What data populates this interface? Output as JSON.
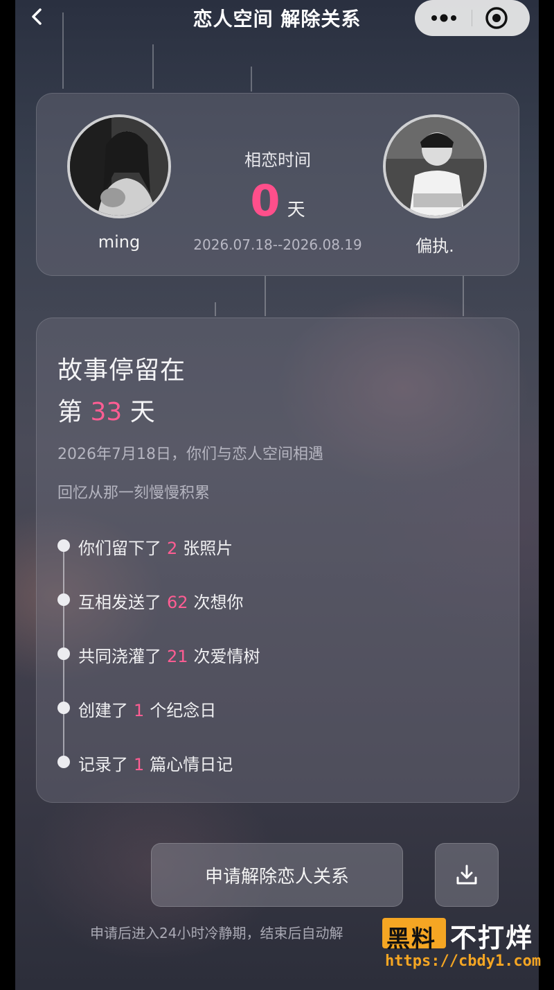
{
  "header": {
    "title": "恋人空间 解除关系",
    "back_icon": "chevron-left-icon",
    "more_icon": "more-dots-icon",
    "close_icon": "target-circle-icon"
  },
  "couple": {
    "left_name": "ming",
    "right_name": "偏执.",
    "love_label": "相恋时间",
    "days": "0",
    "days_unit": "天",
    "date_range": "2026.07.18--2026.08.19"
  },
  "story": {
    "heading": "故事停留在",
    "days_prefix": "第",
    "days_value": "33",
    "days_suffix": "天",
    "subtitle_1": "2026年7月18日，你们与恋人空间相遇",
    "subtitle_2": "回忆从那一刻慢慢积累",
    "items": [
      {
        "prefix": "你们留下了",
        "value": "2",
        "suffix": "张照片"
      },
      {
        "prefix": "互相发送了",
        "value": "62",
        "suffix": "次想你"
      },
      {
        "prefix": "共同浇灌了",
        "value": "21",
        "suffix": "次爱情树"
      },
      {
        "prefix": "创建了",
        "value": "1",
        "suffix": "个纪念日"
      },
      {
        "prefix": "记录了",
        "value": "1",
        "suffix": "篇心情日记"
      }
    ]
  },
  "actions": {
    "unbind_label": "申请解除恋人关系",
    "download_icon": "download-icon",
    "footnote": "申请后进入24小时冷静期，结束后自动解"
  },
  "watermark": {
    "box_text": "黑料",
    "text": "不打烊",
    "url": "https://cbdy1.com"
  },
  "colors": {
    "accent_pink": "#ff4f8b",
    "watermark_orange": "#f5a623"
  }
}
